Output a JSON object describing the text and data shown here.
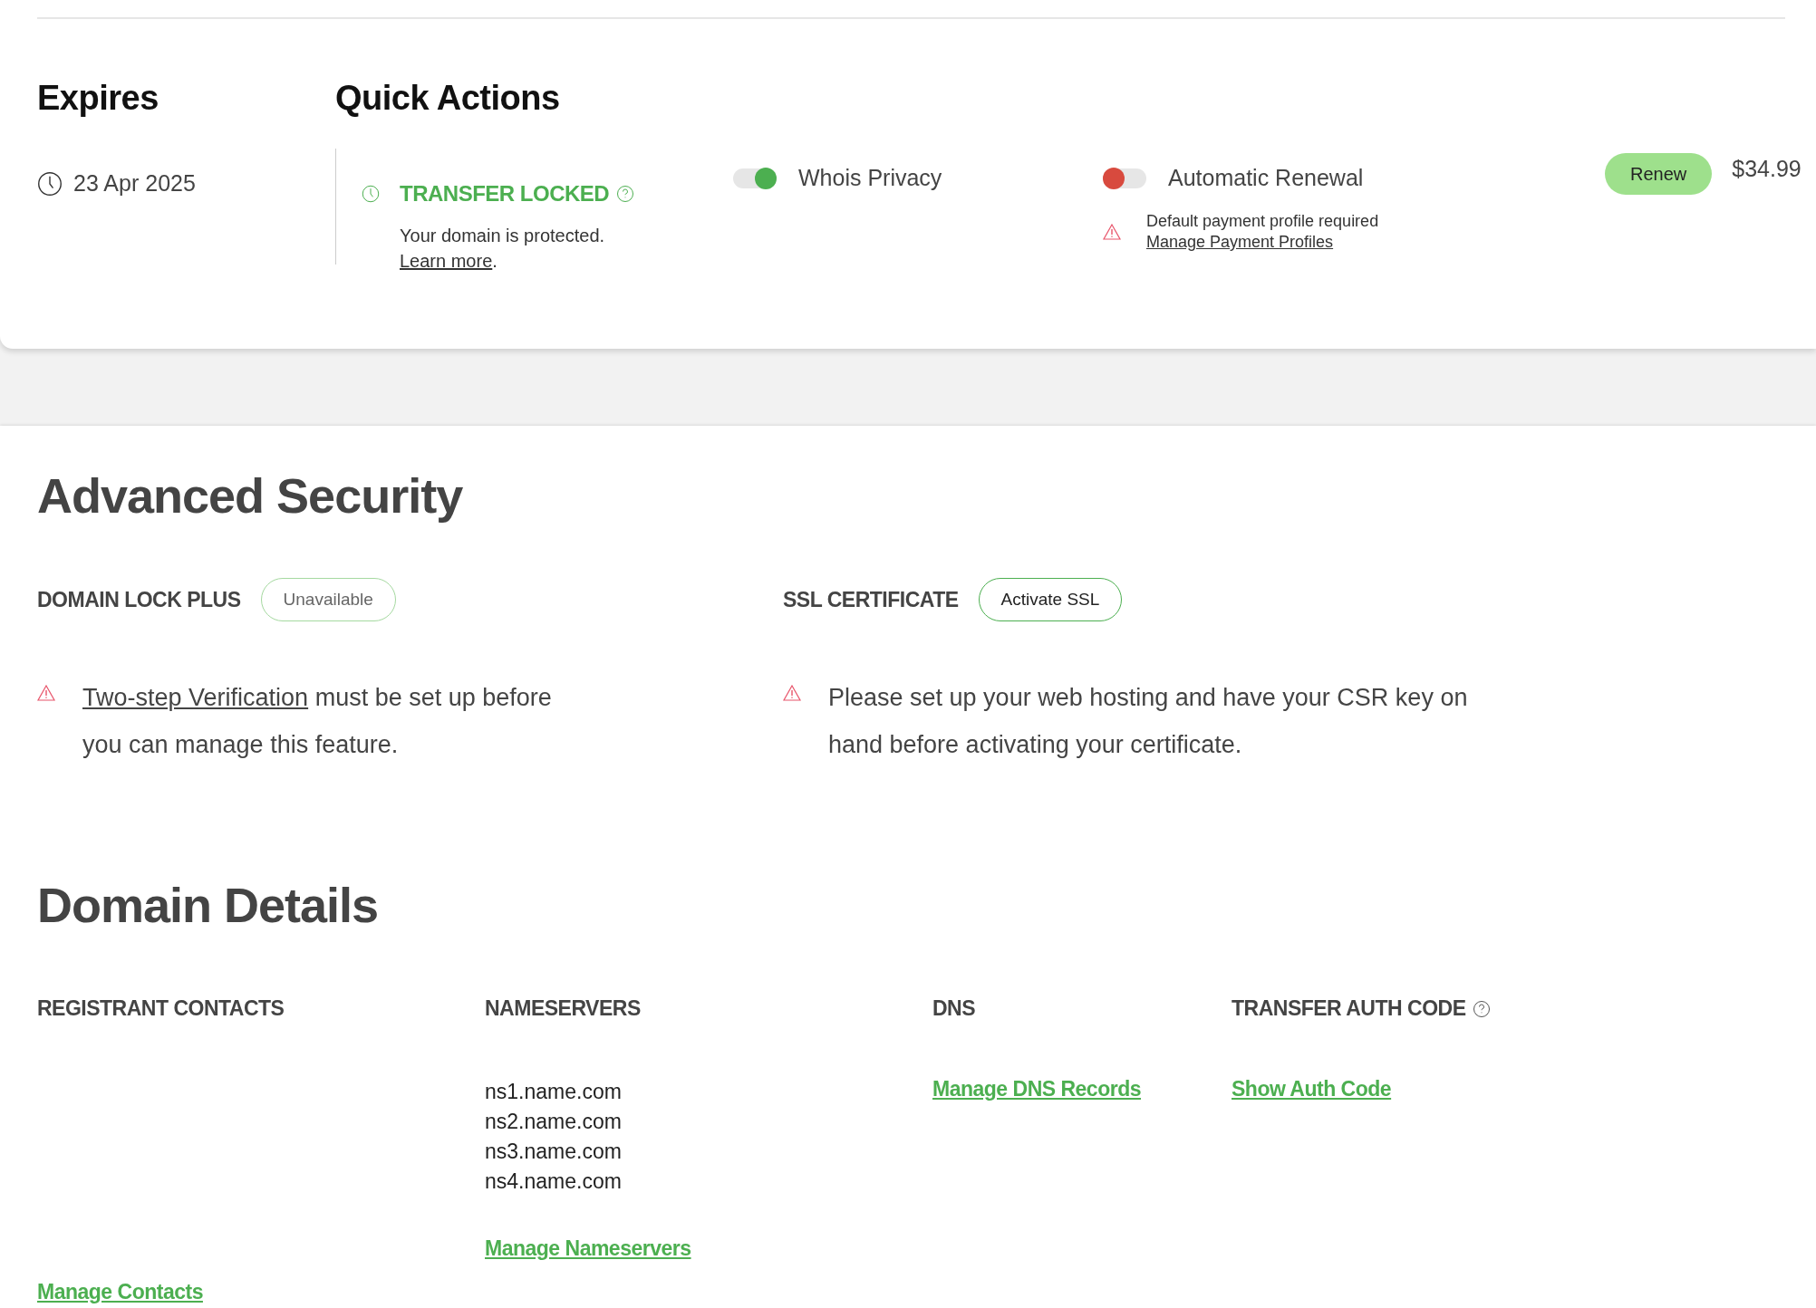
{
  "expires": {
    "title": "Expires",
    "date": "23 Apr 2025"
  },
  "quick_actions": {
    "title": "Quick Actions",
    "transfer": {
      "status": "TRANSFER LOCKED",
      "text": "Your domain is protected.",
      "link": "Learn more",
      "after_link": "."
    },
    "toggles": [
      {
        "label": "Whois Privacy",
        "on": true
      },
      {
        "label": "Automatic Renewal",
        "on": false,
        "warning": "Default payment profile required",
        "link": "Manage Payment Profiles"
      }
    ],
    "renew_button": "Renew",
    "price": "$34.99"
  },
  "advanced_security": {
    "title": "Advanced Security",
    "features": [
      {
        "label": "DOMAIN LOCK PLUS",
        "button": "Unavailable",
        "disabled": true,
        "link": "Two-step Verification",
        "text": "must be set up before you can manage this feature."
      },
      {
        "label": "SSL CERTIFICATE",
        "button": "Activate SSL",
        "disabled": false,
        "text": "Please set up your web hosting and have your CSR key on hand before activating your certificate."
      }
    ]
  },
  "domain_details": {
    "title": "Domain Details",
    "columns": [
      {
        "heading": "REGISTRANT CONTACTS",
        "help": false,
        "link": "Manage Contacts"
      },
      {
        "heading": "NAMESERVERS",
        "help": false,
        "items": [
          "ns1.name.com",
          "ns2.name.com",
          "ns3.name.com",
          "ns4.name.com"
        ],
        "link": "Manage Nameservers"
      },
      {
        "heading": "DNS",
        "help": false,
        "link": "Manage DNS Records"
      },
      {
        "heading": "TRANSFER AUTH CODE",
        "help": true,
        "link": "Show Auth Code"
      }
    ]
  }
}
